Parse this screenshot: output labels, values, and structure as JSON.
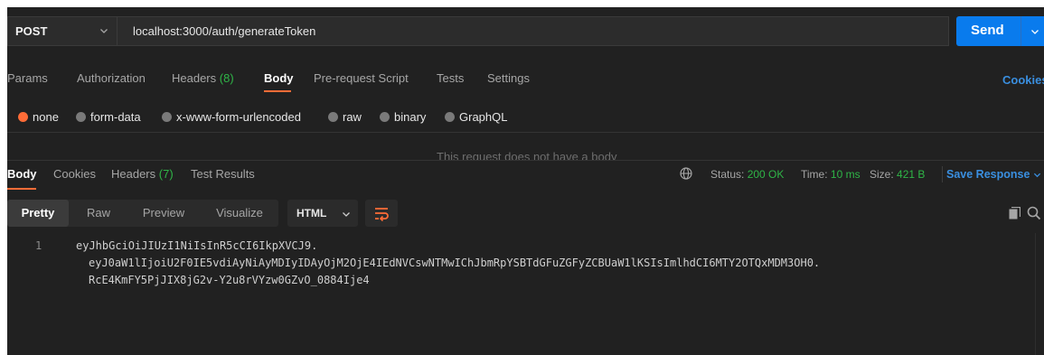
{
  "request": {
    "method": "POST",
    "url": "localhost:3000/auth/generateToken",
    "send_label": "Send"
  },
  "request_tabs": {
    "params": "Params",
    "authorization": "Authorization",
    "headers": "Headers",
    "headers_count": "(8)",
    "body": "Body",
    "pre_request": "Pre-request Script",
    "tests": "Tests",
    "settings": "Settings",
    "cookies": "Cookies"
  },
  "body_types": {
    "none": "none",
    "form_data": "form-data",
    "urlencoded": "x-www-form-urlencoded",
    "raw": "raw",
    "binary": "binary",
    "graphql": "GraphQL",
    "selected": "none"
  },
  "no_body_message": "This request does not have a body",
  "response_tabs": {
    "body": "Body",
    "cookies": "Cookies",
    "headers": "Headers",
    "headers_count": "(7)",
    "test_results": "Test Results"
  },
  "response_status": {
    "status_label": "Status:",
    "status_value": "200 OK",
    "time_label": "Time:",
    "time_value": "10 ms",
    "size_label": "Size:",
    "size_value": "421 B",
    "save_response": "Save Response"
  },
  "view_modes": {
    "pretty": "Pretty",
    "raw": "Raw",
    "preview": "Preview",
    "visualize": "Visualize",
    "format": "HTML"
  },
  "response_body": {
    "line_number": "1",
    "line1": "eyJhbGciOiJIUzI1NiIsInR5cCI6IkpXVCJ9.",
    "line2": "eyJ0aW1lIjoiU2F0IE5vdiAyNiAyMDIyIDAyOjM2OjE4IEdNVCswNTMwIChJbmRpYSBTdGFuZGFyZCBUaW1lKSIsImlhdCI6MTY2OTQxMDM3OH0.",
    "line3": "RcE4KmFY5PjJIX8jG2v-Y2u8rVYzw0GZvO_0884Ije4"
  },
  "colors": {
    "accent": "#ff6c37",
    "send": "#097bed",
    "success": "#2fb547",
    "link": "#3a8fe0"
  }
}
